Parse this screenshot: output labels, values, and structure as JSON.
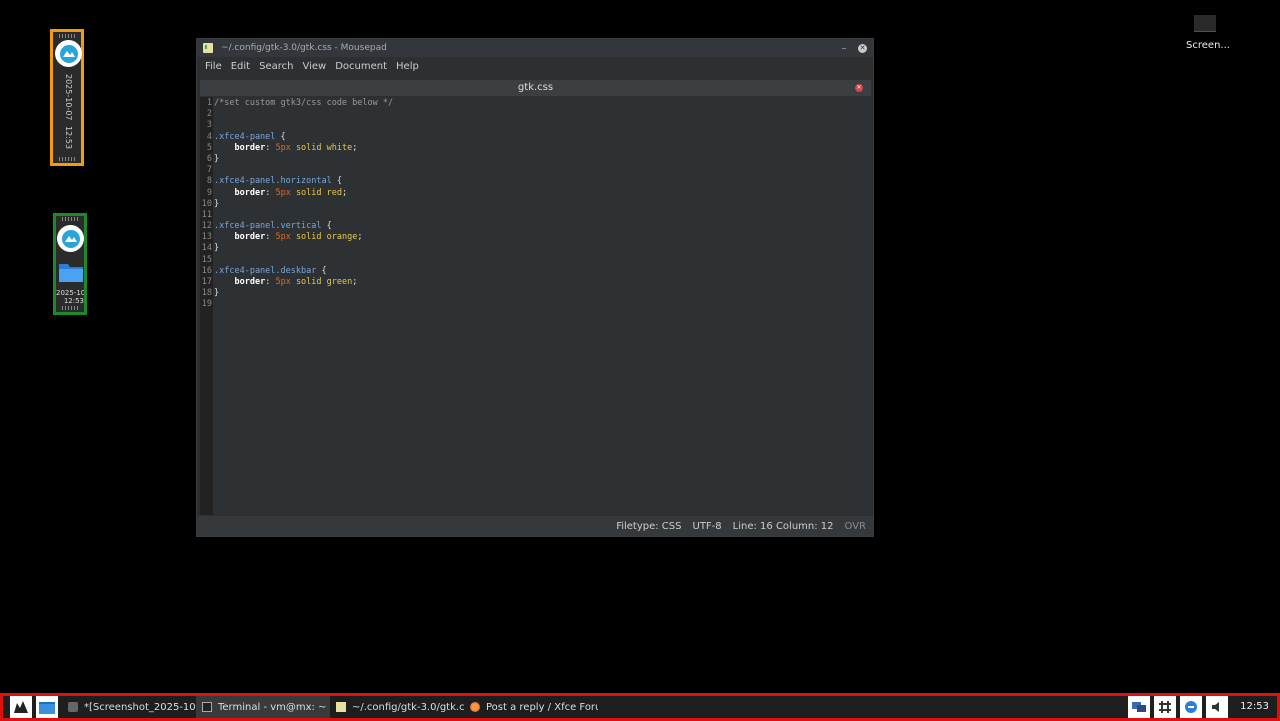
{
  "vertical_panel": {
    "date": "2025-10-07",
    "time": "12:53"
  },
  "deskbar_panel": {
    "date": "2025-10",
    "time": "12:53"
  },
  "desktop_icon": {
    "label": "Screen..."
  },
  "window": {
    "title": "~/.config/gtk-3.0/gtk.css - Mousepad",
    "menu": [
      "File",
      "Edit",
      "Search",
      "View",
      "Document",
      "Help"
    ],
    "tab": "gtk.css",
    "lines": [
      [
        [
          "cmt",
          "/*set custom gtk3/css code below */"
        ]
      ],
      [],
      [],
      [
        [
          "sel",
          ".xfce4-panel"
        ],
        [
          "pun",
          " {"
        ]
      ],
      [
        [
          "pun",
          "    "
        ],
        [
          "prop",
          "border"
        ],
        [
          "pun",
          ": "
        ],
        [
          "num",
          "5px"
        ],
        [
          "pun",
          " "
        ],
        [
          "val",
          "solid white"
        ],
        [
          "pun",
          ";"
        ]
      ],
      [
        [
          "pun",
          "}"
        ]
      ],
      [],
      [
        [
          "sel",
          ".xfce4-panel.horizontal"
        ],
        [
          "pun",
          " {"
        ]
      ],
      [
        [
          "pun",
          "    "
        ],
        [
          "prop",
          "border"
        ],
        [
          "pun",
          ": "
        ],
        [
          "num",
          "5px"
        ],
        [
          "pun",
          " "
        ],
        [
          "val",
          "solid red"
        ],
        [
          "pun",
          ";"
        ]
      ],
      [
        [
          "pun",
          "}"
        ]
      ],
      [],
      [
        [
          "sel",
          ".xfce4-panel.vertical"
        ],
        [
          "pun",
          " {"
        ]
      ],
      [
        [
          "pun",
          "    "
        ],
        [
          "prop",
          "border"
        ],
        [
          "pun",
          ": "
        ],
        [
          "num",
          "5px"
        ],
        [
          "pun",
          " "
        ],
        [
          "val",
          "solid orange"
        ],
        [
          "pun",
          ";"
        ]
      ],
      [
        [
          "pun",
          "}"
        ]
      ],
      [],
      [
        [
          "sel",
          ".xfce4-panel.deskbar"
        ],
        [
          "pun",
          " {"
        ]
      ],
      [
        [
          "pun",
          "    "
        ],
        [
          "prop",
          "border"
        ],
        [
          "pun",
          ": "
        ],
        [
          "num",
          "5px"
        ],
        [
          "pun",
          " "
        ],
        [
          "val",
          "solid green"
        ],
        [
          "pun",
          ";"
        ]
      ],
      [
        [
          "pun",
          "}"
        ]
      ],
      []
    ],
    "status": {
      "filetype": "Filetype: CSS",
      "encoding": "UTF-8",
      "position": "Line: 16 Column: 12",
      "mode": "OVR"
    }
  },
  "taskbar": {
    "tasks": [
      {
        "label": "*[Screenshot_2025-10-...",
        "icon": "image-editor-icon",
        "active": false
      },
      {
        "label": "Terminal - vm@mx: ~",
        "icon": "terminal-icon",
        "active": true
      },
      {
        "label": "~/.config/gtk-3.0/gtk.cs...",
        "icon": "mousepad-icon",
        "active": false
      },
      {
        "label": "Post a reply / Xfce Foru...",
        "icon": "firefox-icon",
        "active": false
      }
    ],
    "clock": "12:53"
  },
  "colors": {
    "horizontal_border": "#e01010",
    "vertical_border": "#f39c12",
    "deskbar_border": "#1a8a2a"
  }
}
